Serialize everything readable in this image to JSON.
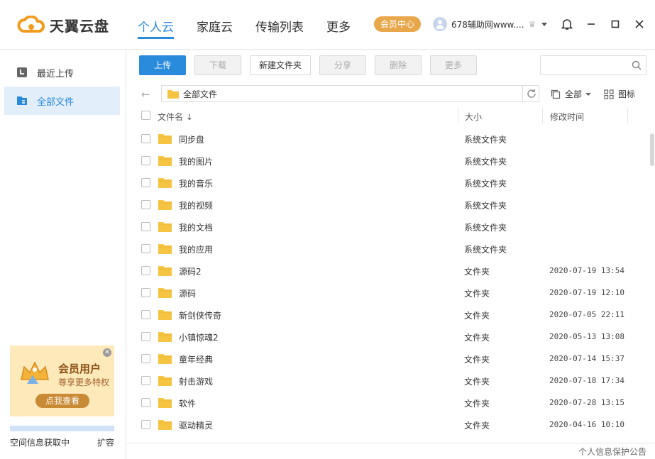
{
  "app": {
    "name": "天翼云盘"
  },
  "nav": {
    "items": [
      "个人云",
      "家庭云",
      "传输列表",
      "更多"
    ]
  },
  "header": {
    "vip_label": "会员中心",
    "username": "678辅助网www...."
  },
  "sidebar": {
    "items": [
      {
        "label": "最近上传",
        "icon": "recent-upload-icon"
      },
      {
        "label": "全部文件",
        "icon": "all-files-icon"
      }
    ],
    "promo": {
      "title": "会员用户",
      "subtitle": "尊享更多特权",
      "button": "点我查看"
    },
    "space_text": "空间信息获取中",
    "expand_label": "扩容"
  },
  "toolbar": {
    "upload": "上传",
    "download": "下载",
    "new_folder": "新建文件夹",
    "share": "分享",
    "delete": "删除",
    "more": "更多",
    "search_placeholder": ""
  },
  "path": {
    "current": "全部文件"
  },
  "view": {
    "filter_label": "全部",
    "icon_view_label": "图标"
  },
  "table": {
    "headers": {
      "name": "文件名 ↓",
      "size": "大小",
      "modified": "修改时间"
    },
    "rows": [
      {
        "name": "同步盘",
        "size": "系统文件夹",
        "modified": ""
      },
      {
        "name": "我的图片",
        "size": "系统文件夹",
        "modified": ""
      },
      {
        "name": "我的音乐",
        "size": "系统文件夹",
        "modified": ""
      },
      {
        "name": "我的视频",
        "size": "系统文件夹",
        "modified": ""
      },
      {
        "name": "我的文档",
        "size": "系统文件夹",
        "modified": ""
      },
      {
        "name": "我的应用",
        "size": "系统文件夹",
        "modified": ""
      },
      {
        "name": "源码2",
        "size": "文件夹",
        "modified": "2020-07-19 13:54"
      },
      {
        "name": "源码",
        "size": "文件夹",
        "modified": "2020-07-19 12:10"
      },
      {
        "name": "新剑侠传奇",
        "size": "文件夹",
        "modified": "2020-07-05 22:11"
      },
      {
        "name": "小镇惊魂2",
        "size": "文件夹",
        "modified": "2020-05-13 13:08"
      },
      {
        "name": "童年经典",
        "size": "文件夹",
        "modified": "2020-07-14 15:37"
      },
      {
        "name": "射击游戏",
        "size": "文件夹",
        "modified": "2020-07-18 17:34"
      },
      {
        "name": "软件",
        "size": "文件夹",
        "modified": "2020-07-28 13:15"
      },
      {
        "name": "驱动精灵",
        "size": "文件夹",
        "modified": "2020-04-16 10:10"
      }
    ]
  },
  "footer": {
    "privacy": "个人信息保护公告"
  },
  "colors": {
    "accent": "#2a8bdc",
    "vip": "#e8a74a",
    "folder": "#f6c443"
  }
}
